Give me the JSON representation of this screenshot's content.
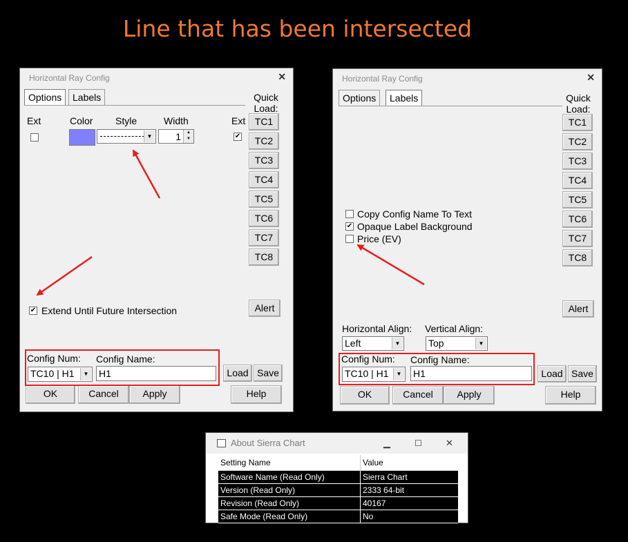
{
  "headline": "Line that has been intersected",
  "dialog_left": {
    "title": "Horizontal Ray Config",
    "tabs": [
      "Options",
      "Labels"
    ],
    "quick_load": "Quick Load:",
    "headers": {
      "ext": "Ext",
      "color": "Color",
      "style": "Style",
      "width": "Width",
      "ext2": "Ext"
    },
    "width_value": "1",
    "tc_buttons": [
      "TC1",
      "TC2",
      "TC3",
      "TC4",
      "TC5",
      "TC6",
      "TC7",
      "TC8"
    ],
    "extend_label": "Extend Until Future Intersection",
    "alert": "Alert",
    "config_num_label": "Config Num:",
    "config_num_value": "TC10 | H1",
    "config_name_label": "Config Name:",
    "config_name_value": "H1",
    "load": "Load",
    "save": "Save",
    "ok": "OK",
    "cancel": "Cancel",
    "apply": "Apply",
    "help": "Help",
    "line_color": "#8080ff"
  },
  "dialog_right": {
    "title": "Horizontal Ray Config",
    "tabs": [
      "Options",
      "Labels"
    ],
    "quick_load": "Quick Load:",
    "tc_buttons": [
      "TC1",
      "TC2",
      "TC3",
      "TC4",
      "TC5",
      "TC6",
      "TC7",
      "TC8"
    ],
    "checks": [
      {
        "label": "Copy Config Name To Text",
        "checked": false
      },
      {
        "label": "Opaque Label Background",
        "checked": true
      },
      {
        "label": "Price (EV)",
        "checked": false
      }
    ],
    "alert": "Alert",
    "h_align_label": "Horizontal Align:",
    "h_align_value": "Left",
    "v_align_label": "Vertical Align:",
    "v_align_value": "Top",
    "config_num_label": "Config Num:",
    "config_num_value": "TC10 | H1",
    "config_name_label": "Config Name:",
    "config_name_value": "H1",
    "load": "Load",
    "save": "Save",
    "ok": "OK",
    "cancel": "Cancel",
    "apply": "Apply",
    "help": "Help"
  },
  "about": {
    "title": "About Sierra Chart",
    "columns": [
      "Setting Name",
      "Value"
    ],
    "rows": [
      [
        "Software Name (Read Only)",
        "Sierra Chart"
      ],
      [
        "Version (Read Only)",
        "2333 64-bit"
      ],
      [
        "Revision (Read Only)",
        "40167"
      ],
      [
        "Safe Mode (Read Only)",
        "No"
      ]
    ]
  },
  "colors": {
    "headline": "#f07a2c",
    "annotation": "#e81e1e"
  }
}
